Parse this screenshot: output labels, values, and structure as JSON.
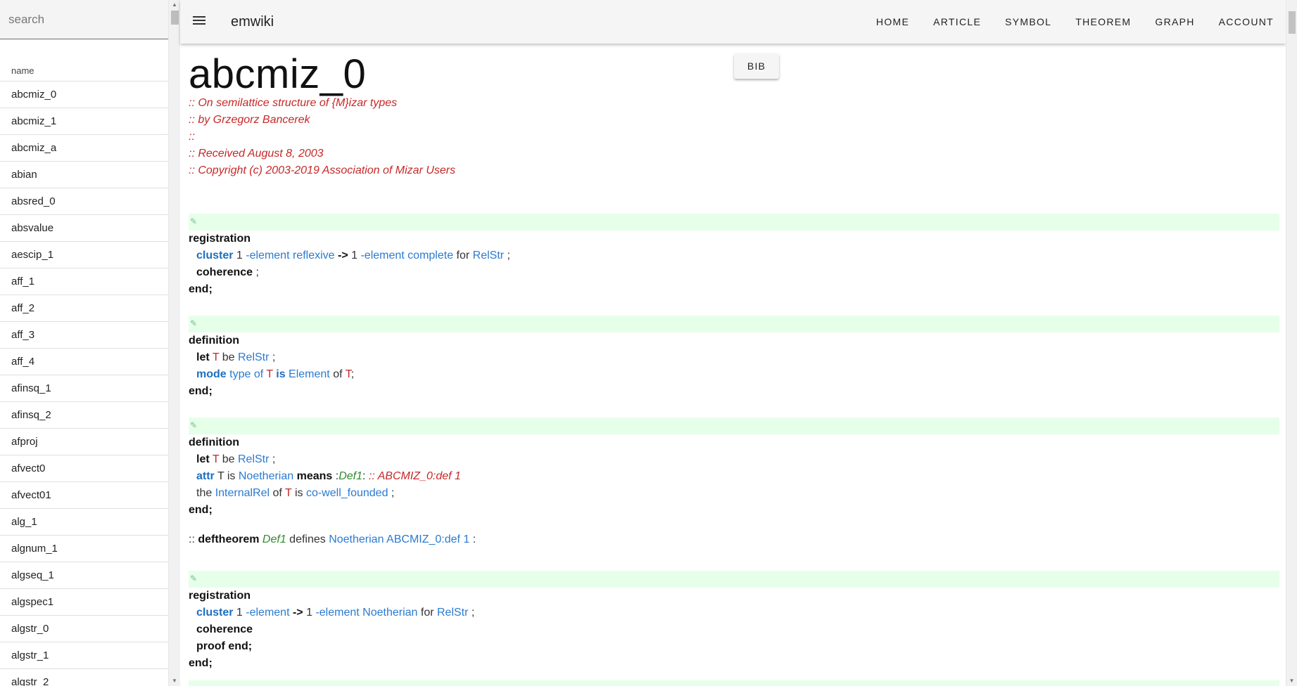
{
  "search": {
    "placeholder": "search"
  },
  "sidebar": {
    "header": "name",
    "items": [
      "abcmiz_0",
      "abcmiz_1",
      "abcmiz_a",
      "abian",
      "absred_0",
      "absvalue",
      "aescip_1",
      "aff_1",
      "aff_2",
      "aff_3",
      "aff_4",
      "afinsq_1",
      "afinsq_2",
      "afproj",
      "afvect0",
      "afvect01",
      "alg_1",
      "algnum_1",
      "algseq_1",
      "algspec1",
      "algstr_0",
      "algstr_1",
      "algstr_2"
    ]
  },
  "topbar": {
    "title": "emwiki",
    "nav": [
      "HOME",
      "ARTICLE",
      "SYMBOL",
      "THEOREM",
      "GRAPH",
      "ACCOUNT"
    ]
  },
  "article": {
    "title": "abcmiz_0",
    "bib_label": "BIB",
    "header_comments": [
      ":: On semilattice structure of {M}izar types",
      ":: by Grzegorz Bancerek",
      "::",
      ":: Received August 8, 2003",
      ":: Copyright (c) 2003-2019 Association of Mizar Users"
    ],
    "blocks": [
      {
        "lines": [
          [
            {
              "t": "kw",
              "v": "registration"
            }
          ],
          [
            {
              "t": "kw-blue",
              "v": "cluster"
            },
            {
              "t": "txt",
              "v": " 1 "
            },
            {
              "t": "link",
              "v": "-element"
            },
            {
              "t": "txt",
              "v": " "
            },
            {
              "t": "link",
              "v": "reflexive"
            },
            {
              "t": "txt",
              "v": " "
            },
            {
              "t": "kw",
              "v": "->"
            },
            {
              "t": "txt",
              "v": " 1 "
            },
            {
              "t": "link",
              "v": "-element"
            },
            {
              "t": "txt",
              "v": " "
            },
            {
              "t": "link",
              "v": "complete"
            },
            {
              "t": "txt",
              "v": " for "
            },
            {
              "t": "link",
              "v": "RelStr"
            },
            {
              "t": "txt",
              "v": " ;"
            }
          ],
          [
            {
              "t": "kw",
              "v": "coherence"
            },
            {
              "t": "txt",
              "v": " ;"
            }
          ],
          [
            {
              "t": "kw",
              "v": "end;"
            }
          ]
        ]
      },
      {
        "lines": [
          [
            {
              "t": "kw",
              "v": "definition"
            }
          ],
          [
            {
              "t": "kw",
              "v": "let"
            },
            {
              "t": "txt",
              "v": " "
            },
            {
              "t": "cmt-plain",
              "v": "T"
            },
            {
              "t": "txt",
              "v": " be "
            },
            {
              "t": "link",
              "v": "RelStr"
            },
            {
              "t": "txt",
              "v": " ;"
            }
          ],
          [
            {
              "t": "kw-blue",
              "v": "mode"
            },
            {
              "t": "txt",
              "v": " "
            },
            {
              "t": "link",
              "v": "type of"
            },
            {
              "t": "txt",
              "v": " "
            },
            {
              "t": "cmt-plain",
              "v": "T"
            },
            {
              "t": "txt",
              "v": " "
            },
            {
              "t": "kw-blue",
              "v": "is"
            },
            {
              "t": "txt",
              "v": " "
            },
            {
              "t": "link",
              "v": "Element"
            },
            {
              "t": "txt",
              "v": " of "
            },
            {
              "t": "cmt-plain",
              "v": "T"
            },
            {
              "t": "txt",
              "v": ";"
            }
          ],
          [
            {
              "t": "kw",
              "v": "end;"
            }
          ]
        ]
      },
      {
        "lines": [
          [
            {
              "t": "kw",
              "v": "definition"
            }
          ],
          [
            {
              "t": "kw",
              "v": "let"
            },
            {
              "t": "txt",
              "v": " "
            },
            {
              "t": "cmt-plain",
              "v": "T"
            },
            {
              "t": "txt",
              "v": " be "
            },
            {
              "t": "link",
              "v": "RelStr"
            },
            {
              "t": "txt",
              "v": " ;"
            }
          ],
          [
            {
              "t": "kw-blue",
              "v": "attr"
            },
            {
              "t": "txt",
              "v": " T is "
            },
            {
              "t": "link",
              "v": "Noetherian"
            },
            {
              "t": "txt",
              "v": " "
            },
            {
              "t": "kw",
              "v": "means"
            },
            {
              "t": "txt",
              "v": " :"
            },
            {
              "t": "lbl",
              "v": "Def1"
            },
            {
              "t": "txt",
              "v": ": "
            },
            {
              "t": "cmt",
              "v": ":: ABCMIZ_0:def 1"
            }
          ],
          [
            {
              "t": "txt",
              "v": "the "
            },
            {
              "t": "link",
              "v": "InternalRel"
            },
            {
              "t": "txt",
              "v": " of "
            },
            {
              "t": "cmt-plain",
              "v": "T"
            },
            {
              "t": "txt",
              "v": " is "
            },
            {
              "t": "link",
              "v": "co-well_founded"
            },
            {
              "t": "txt",
              "v": " ;"
            }
          ],
          [
            {
              "t": "kw",
              "v": "end;"
            }
          ]
        ]
      },
      {
        "lines": [
          [
            {
              "t": "kw",
              "v": "registration"
            }
          ],
          [
            {
              "t": "kw-blue",
              "v": "cluster"
            },
            {
              "t": "txt",
              "v": " 1 "
            },
            {
              "t": "link",
              "v": "-element"
            },
            {
              "t": "txt",
              "v": " "
            },
            {
              "t": "kw",
              "v": "->"
            },
            {
              "t": "txt",
              "v": " 1 "
            },
            {
              "t": "link",
              "v": "-element"
            },
            {
              "t": "txt",
              "v": " "
            },
            {
              "t": "link",
              "v": "Noetherian"
            },
            {
              "t": "txt",
              "v": " for "
            },
            {
              "t": "link",
              "v": "RelStr"
            },
            {
              "t": "txt",
              "v": " ;"
            }
          ],
          [
            {
              "t": "kw",
              "v": "coherence"
            }
          ],
          [
            {
              "t": "kw",
              "v": "proof end;"
            }
          ],
          [
            {
              "t": "kw",
              "v": "end;"
            }
          ]
        ]
      }
    ],
    "deftheorem": [
      {
        "t": "txt",
        "v": ":: "
      },
      {
        "t": "kw",
        "v": "deftheorem"
      },
      {
        "t": "txt",
        "v": " "
      },
      {
        "t": "lbl",
        "v": "Def1"
      },
      {
        "t": "txt",
        "v": " defines "
      },
      {
        "t": "link",
        "v": "Noetherian"
      },
      {
        "t": "txt",
        "v": " "
      },
      {
        "t": "link",
        "v": "ABCMIZ_0:def 1"
      },
      {
        "t": "txt",
        "v": " :"
      }
    ]
  },
  "icons": {
    "menu": "menu-icon",
    "edit": "edit-icon"
  },
  "colors": {
    "keyword_blue": "#1e6fbf",
    "link": "#2a7bd0",
    "comment": "#c62828",
    "label": "#2e8b2e",
    "edit_bar": "#e6ffe9"
  }
}
